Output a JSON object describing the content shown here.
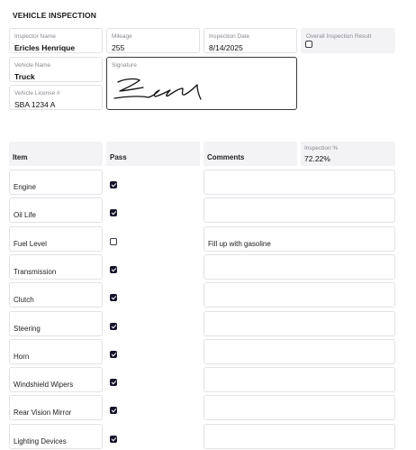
{
  "form": {
    "title": "VEHICLE INSPECTION",
    "inspector_name": {
      "label": "Inspector Name",
      "value": "Ericles Henrique"
    },
    "mileage": {
      "label": "Mileage",
      "value": "255"
    },
    "inspection_date": {
      "label": "Inspection Date",
      "value": "8/14/2025"
    },
    "overall_result": {
      "label": "Overall Inspection Result",
      "checked": false
    },
    "vehicle_name": {
      "label": "Vehicle Name",
      "value": "Truck"
    },
    "vehicle_license": {
      "label": "Vehicle License #",
      "value": "SBA 1234 A"
    },
    "signature": {
      "label": "Signature"
    }
  },
  "table": {
    "headers": {
      "item": "Item",
      "pass": "Pass",
      "comments": "Comments",
      "percent_label": "Inspection %",
      "percent_value": "72.22%"
    },
    "rows": [
      {
        "item": "Engine",
        "pass": true,
        "comment": ""
      },
      {
        "item": "Oil Life",
        "pass": true,
        "comment": ""
      },
      {
        "item": "Fuel Level",
        "pass": false,
        "comment": "Fill up with gasoline"
      },
      {
        "item": "Transmission",
        "pass": true,
        "comment": ""
      },
      {
        "item": "Clutch",
        "pass": true,
        "comment": ""
      },
      {
        "item": "Steering",
        "pass": true,
        "comment": ""
      },
      {
        "item": "Horn",
        "pass": true,
        "comment": ""
      },
      {
        "item": "Windshield Wipers",
        "pass": true,
        "comment": ""
      },
      {
        "item": "Rear Vision Mirror",
        "pass": true,
        "comment": ""
      },
      {
        "item": "Lighting Devices",
        "pass": true,
        "comment": ""
      }
    ]
  }
}
